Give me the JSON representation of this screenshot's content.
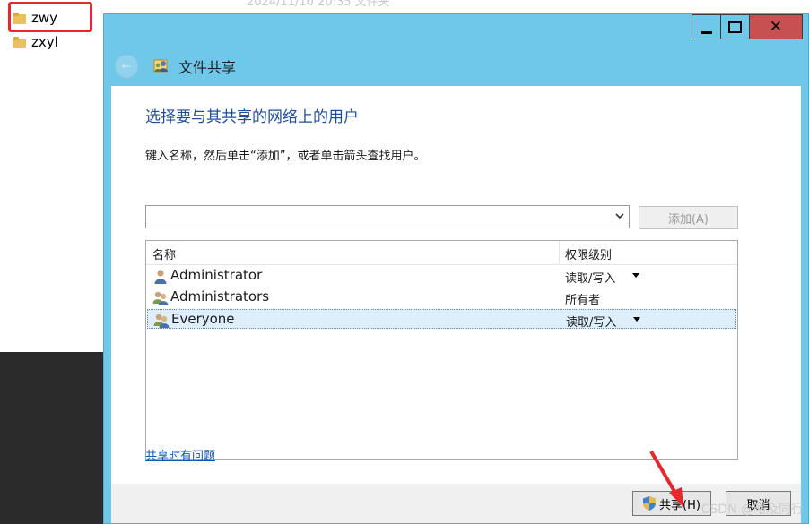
{
  "explorer": {
    "items": [
      {
        "name": "zwy"
      },
      {
        "name": "zxyl"
      }
    ],
    "top_strip_text": "2024/11/10 20:35 文件夹"
  },
  "dialog": {
    "title": "文件共享",
    "heading": "选择要与其共享的网络上的用户",
    "instruction": "键入名称，然后单击“添加”，或者单击箭头查找用户。",
    "user_input": {
      "value": ""
    },
    "add_button_label": "添加(A)",
    "list": {
      "columns": [
        "名称",
        "权限级别"
      ],
      "rows": [
        {
          "name": "Administrator",
          "permission": "读取/写入",
          "has_dropdown": true,
          "icon": "user-icon",
          "selected": false
        },
        {
          "name": "Administrators",
          "permission": "所有者",
          "has_dropdown": false,
          "icon": "group-icon",
          "selected": false
        },
        {
          "name": "Everyone",
          "permission": "读取/写入",
          "has_dropdown": true,
          "icon": "group-icon",
          "selected": true
        }
      ]
    },
    "help_link": "共享时有问题",
    "share_button_label": "共享(H)",
    "cancel_button_label": "取消"
  },
  "watermark": "CSDN @略及同行",
  "colors": {
    "titlebar": "#6fc7ea",
    "close_button": "#c75050",
    "heading": "#1e4e9a",
    "link": "#0a58b8",
    "highlight_box": "#e8262b",
    "selected_row": "#dfeefb"
  }
}
